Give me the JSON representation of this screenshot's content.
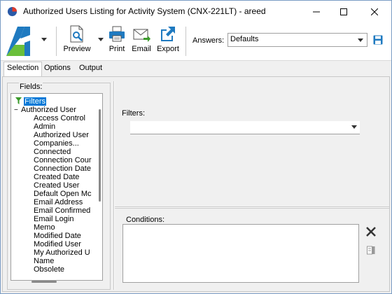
{
  "window": {
    "title": "Authorized Users Listing for Activity System (CNX-221LT) - areed"
  },
  "toolbar": {
    "preview_label": "Preview",
    "print_label": "Print",
    "email_label": "Email",
    "export_label": "Export",
    "answers_label": "Answers:",
    "answers_value": "Defaults",
    "brand_color": "#1f7ac0",
    "accent_green": "#6abf3a"
  },
  "tabs": [
    {
      "label": "Selection",
      "active": true
    },
    {
      "label": "Options",
      "active": false
    },
    {
      "label": "Output",
      "active": false
    }
  ],
  "fields": {
    "legend": "Fields:",
    "root_label": "Filters",
    "group_label": "Authorized User",
    "items": [
      "Access Control",
      "Admin",
      "Authorized User",
      "Companies...",
      "Connected",
      "Connection Cour",
      "Connection Date",
      "Created Date",
      "Created User",
      "Default Open Mc",
      "Email Address",
      "Email Confirmed",
      "Email Login",
      "Memo",
      "Modified Date",
      "Modified User",
      "My Authorized U",
      "Name",
      "Obsolete"
    ]
  },
  "filters": {
    "label": "Filters:",
    "value": ""
  },
  "conditions": {
    "label": "Conditions:"
  }
}
